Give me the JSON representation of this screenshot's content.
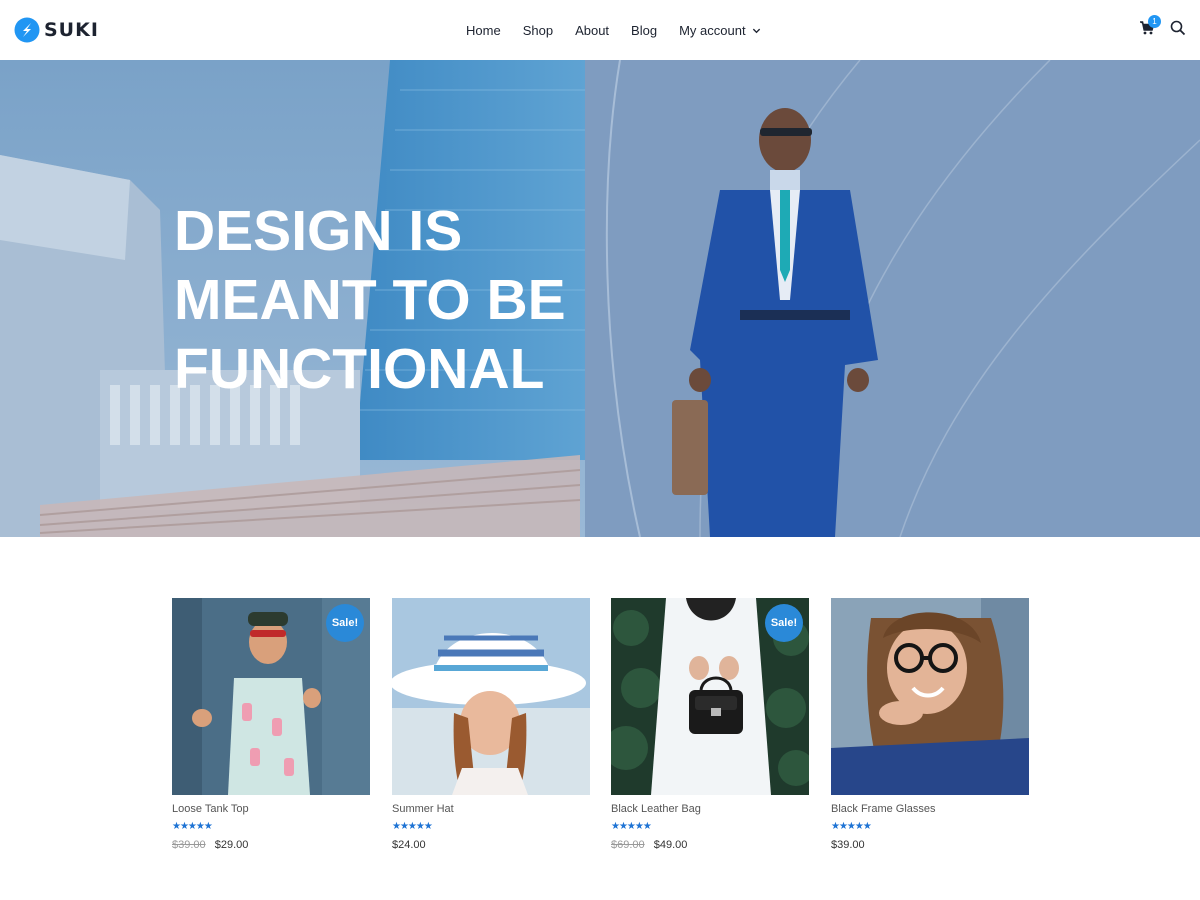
{
  "brand": {
    "name": "SUKI",
    "accent": "#2196f3"
  },
  "nav": {
    "items": [
      {
        "label": "Home"
      },
      {
        "label": "Shop"
      },
      {
        "label": "About"
      },
      {
        "label": "Blog"
      },
      {
        "label": "My account"
      }
    ]
  },
  "header": {
    "cart_count": "1",
    "cart_icon": "cart-icon",
    "search_icon": "search-icon"
  },
  "hero": {
    "title": "DESIGN IS MEANT TO BE FUNCTIONAL"
  },
  "products": [
    {
      "name": "Loose Tank Top",
      "sale_badge": "Sale!",
      "rating": "★★★★★",
      "old_price": "$39.00",
      "price": "$29.00"
    },
    {
      "name": "Summer Hat",
      "sale_badge": "",
      "rating": "★★★★★",
      "old_price": "",
      "price": "$24.00"
    },
    {
      "name": "Black Leather Bag",
      "sale_badge": "Sale!",
      "rating": "★★★★★",
      "old_price": "$69.00",
      "price": "$49.00"
    },
    {
      "name": "Black Frame Glasses",
      "sale_badge": "",
      "rating": "★★★★★",
      "old_price": "",
      "price": "$39.00"
    }
  ]
}
